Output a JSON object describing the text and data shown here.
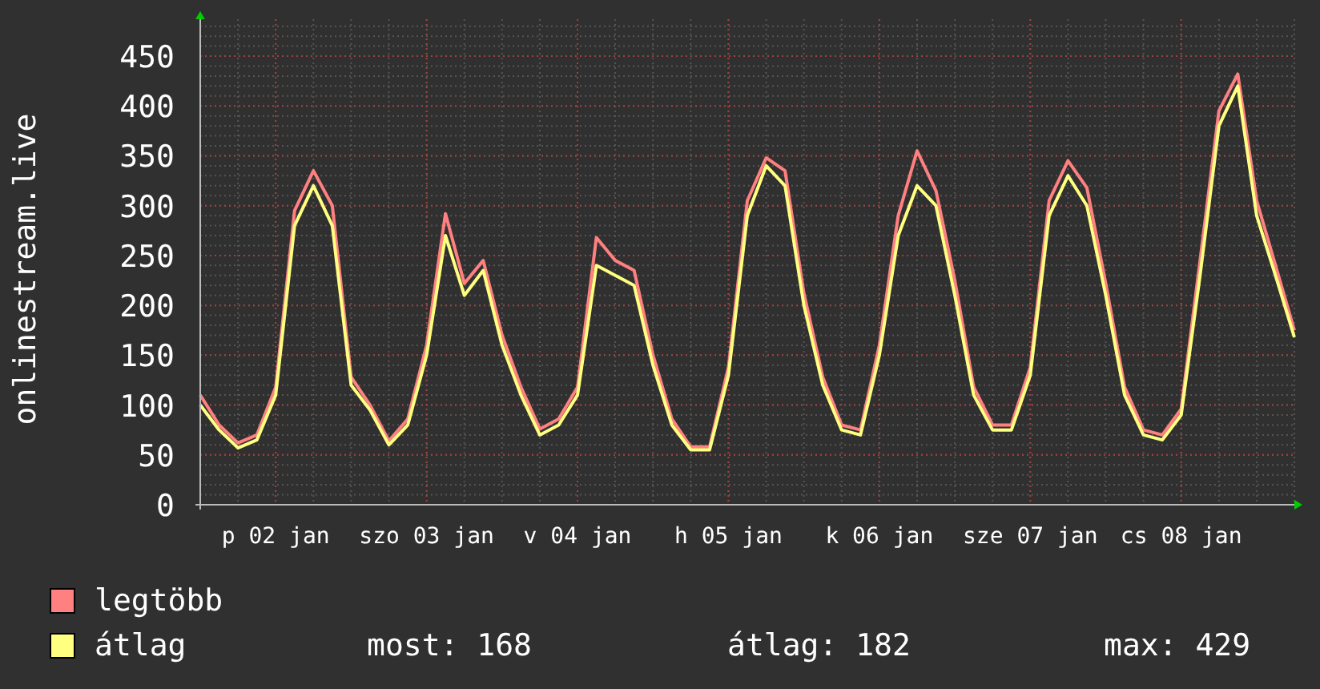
{
  "chart_data": {
    "type": "line",
    "ylabel": "onlinestream.live",
    "categories": [
      null,
      null,
      null,
      null,
      "p 02 jan",
      null,
      null,
      null,
      null,
      null,
      null,
      null,
      "szo 03 jan",
      null,
      null,
      null,
      null,
      null,
      null,
      null,
      "v 04 jan",
      null,
      null,
      null,
      null,
      null,
      null,
      null,
      "h 05 jan",
      null,
      null,
      null,
      null,
      null,
      null,
      null,
      "k 06 jan",
      null,
      null,
      null,
      null,
      null,
      null,
      null,
      "sze 07 jan",
      null,
      null,
      null,
      null,
      null,
      null,
      null,
      "cs 08 jan",
      null,
      null,
      null,
      null,
      null,
      null
    ],
    "series": [
      {
        "name": "legtöbb",
        "color": "#ff8080",
        "values": [
          110,
          80,
          62,
          70,
          118,
          295,
          335,
          300,
          128,
          100,
          64,
          86,
          160,
          292,
          222,
          245,
          170,
          118,
          76,
          86,
          118,
          268,
          245,
          235,
          150,
          86,
          58,
          58,
          138,
          305,
          348,
          335,
          212,
          128,
          80,
          75,
          160,
          290,
          355,
          315,
          225,
          118,
          80,
          80,
          138,
          305,
          345,
          318,
          222,
          118,
          75,
          70,
          96,
          245,
          395,
          432,
          305,
          240,
          175
        ]
      },
      {
        "name": "átlag",
        "color": "#ffff80",
        "values": [
          100,
          75,
          57,
          65,
          110,
          280,
          320,
          280,
          120,
          95,
          60,
          80,
          150,
          270,
          210,
          235,
          160,
          110,
          70,
          80,
          110,
          240,
          230,
          220,
          140,
          80,
          55,
          55,
          130,
          290,
          340,
          320,
          200,
          120,
          75,
          70,
          150,
          270,
          320,
          300,
          210,
          110,
          75,
          75,
          130,
          290,
          330,
          300,
          210,
          110,
          70,
          65,
          90,
          230,
          380,
          420,
          290,
          230,
          168
        ]
      }
    ],
    "ylim": [
      0,
      487
    ],
    "grid": true,
    "yticks": [
      0,
      50,
      100,
      150,
      200,
      250,
      300,
      350,
      400,
      450
    ]
  },
  "stats": [
    "most: 168",
    "átlag: 182",
    "max: 429"
  ]
}
